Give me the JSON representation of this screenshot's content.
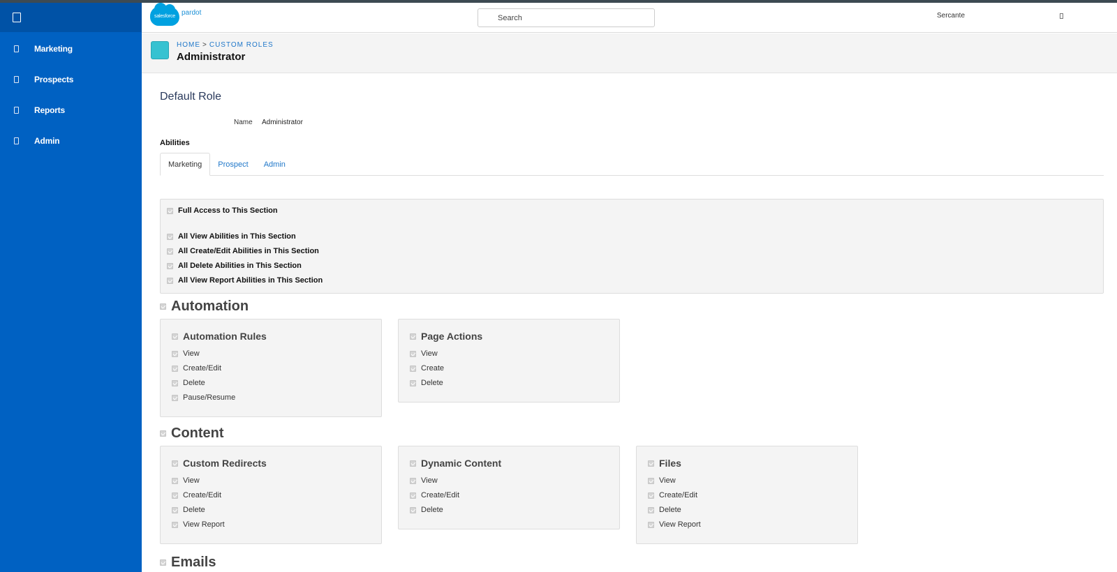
{
  "header": {
    "logo_cloud": "salesforce",
    "logo_product": "pardot",
    "search_placeholder": "Search",
    "user_name": "Sercante"
  },
  "sidebar": {
    "items": [
      {
        "label": "Marketing"
      },
      {
        "label": "Prospects"
      },
      {
        "label": "Reports"
      },
      {
        "label": "Admin"
      }
    ]
  },
  "breadcrumb": {
    "home": "HOME",
    "separator": ">",
    "current": "CUSTOM ROLES"
  },
  "page": {
    "title": "Administrator",
    "section_title": "Default Role",
    "name_label": "Name",
    "name_value": "Administrator",
    "abilities_label": "Abilities"
  },
  "tabs": [
    {
      "label": "Marketing",
      "active": true
    },
    {
      "label": "Prospect",
      "active": false
    },
    {
      "label": "Admin",
      "active": false
    }
  ],
  "full_access": {
    "full": "Full Access to This Section",
    "view": "All View Abilities in This Section",
    "create_edit": "All Create/Edit Abilities in This Section",
    "delete": "All Delete Abilities in This Section",
    "view_report": "All View Report Abilities in This Section"
  },
  "sections": {
    "automation": {
      "title": "Automation",
      "cards": [
        {
          "title": "Automation Rules",
          "items": [
            "View",
            "Create/Edit",
            "Delete",
            "Pause/Resume"
          ]
        },
        {
          "title": "Page Actions",
          "items": [
            "View",
            "Create",
            "Delete"
          ]
        }
      ]
    },
    "content": {
      "title": "Content",
      "cards": [
        {
          "title": "Custom Redirects",
          "items": [
            "View",
            "Create/Edit",
            "Delete",
            "View Report"
          ]
        },
        {
          "title": "Dynamic Content",
          "items": [
            "View",
            "Create/Edit",
            "Delete"
          ]
        },
        {
          "title": "Files",
          "items": [
            "View",
            "Create/Edit",
            "Delete",
            "View Report"
          ]
        }
      ]
    },
    "emails": {
      "title": "Emails"
    }
  },
  "colors": {
    "sidebar": "#0061c2",
    "link": "#1f77c9",
    "role_icon": "#36c2d1"
  }
}
